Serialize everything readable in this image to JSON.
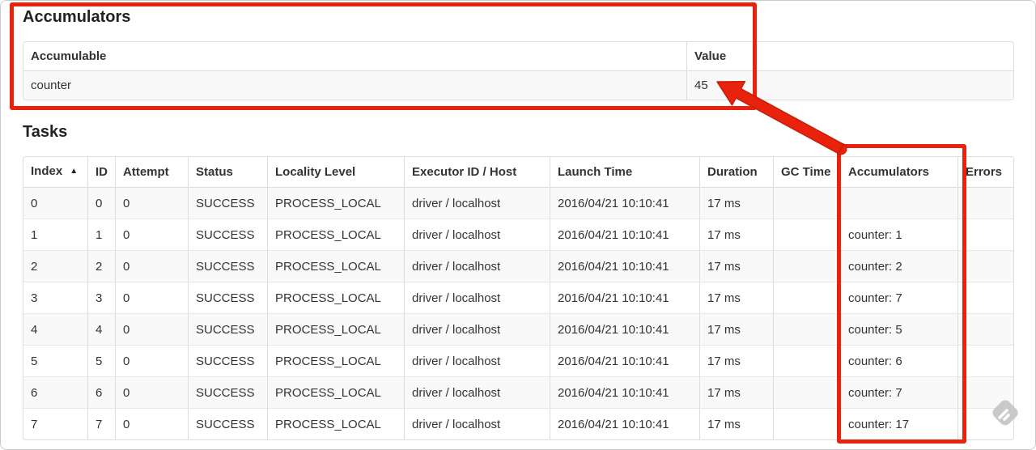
{
  "accumulators_section": {
    "title": "Accumulators",
    "table": {
      "headers": [
        "Accumulable",
        "Value"
      ],
      "rows": [
        [
          "counter",
          "45"
        ]
      ]
    }
  },
  "tasks_section": {
    "title": "Tasks",
    "table": {
      "sort_indicator": "▲",
      "headers": [
        "Index",
        "ID",
        "Attempt",
        "Status",
        "Locality Level",
        "Executor ID / Host",
        "Launch Time",
        "Duration",
        "GC Time",
        "Accumulators",
        "Errors"
      ],
      "rows": [
        [
          "0",
          "0",
          "0",
          "SUCCESS",
          "PROCESS_LOCAL",
          "driver / localhost",
          "2016/04/21 10:10:41",
          "17 ms",
          "",
          "",
          ""
        ],
        [
          "1",
          "1",
          "0",
          "SUCCESS",
          "PROCESS_LOCAL",
          "driver / localhost",
          "2016/04/21 10:10:41",
          "17 ms",
          "",
          "counter: 1",
          ""
        ],
        [
          "2",
          "2",
          "0",
          "SUCCESS",
          "PROCESS_LOCAL",
          "driver / localhost",
          "2016/04/21 10:10:41",
          "17 ms",
          "",
          "counter: 2",
          ""
        ],
        [
          "3",
          "3",
          "0",
          "SUCCESS",
          "PROCESS_LOCAL",
          "driver / localhost",
          "2016/04/21 10:10:41",
          "17 ms",
          "",
          "counter: 7",
          ""
        ],
        [
          "4",
          "4",
          "0",
          "SUCCESS",
          "PROCESS_LOCAL",
          "driver / localhost",
          "2016/04/21 10:10:41",
          "17 ms",
          "",
          "counter: 5",
          ""
        ],
        [
          "5",
          "5",
          "0",
          "SUCCESS",
          "PROCESS_LOCAL",
          "driver / localhost",
          "2016/04/21 10:10:41",
          "17 ms",
          "",
          "counter: 6",
          ""
        ],
        [
          "6",
          "6",
          "0",
          "SUCCESS",
          "PROCESS_LOCAL",
          "driver / localhost",
          "2016/04/21 10:10:41",
          "17 ms",
          "",
          "counter: 7",
          ""
        ],
        [
          "7",
          "7",
          "0",
          "SUCCESS",
          "PROCESS_LOCAL",
          "driver / localhost",
          "2016/04/21 10:10:41",
          "17 ms",
          "",
          "counter: 17",
          ""
        ]
      ]
    }
  },
  "annotations": {
    "color": "#e8220d"
  },
  "icons": {
    "sort": "sort-ascending-icon",
    "watermark": "feedly-watermark-icon"
  }
}
